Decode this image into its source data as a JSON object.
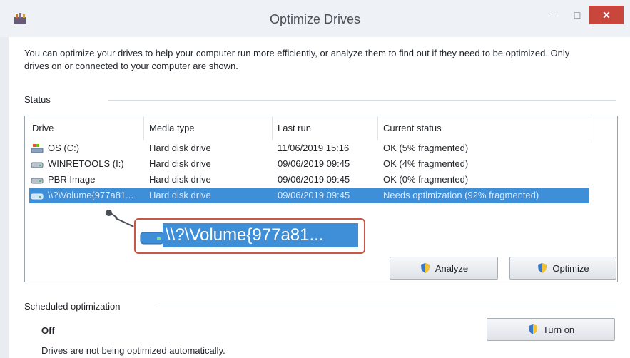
{
  "window": {
    "title": "Optimize Drives",
    "min_symbol": "–",
    "max_symbol": "□",
    "close_symbol": "✕"
  },
  "intro_text": "You can optimize your drives to help your computer run more efficiently, or analyze them to find out if they need to be optimized. Only drives on or connected to your computer are shown.",
  "status": {
    "label": "Status",
    "columns": [
      "Drive",
      "Media type",
      "Last run",
      "Current status"
    ],
    "drives": [
      {
        "drive": "OS (C:)",
        "media": "Hard disk drive",
        "last_run": "11/06/2019 15:16",
        "status": "OK (5% fragmented)",
        "icon": "system-drive-icon"
      },
      {
        "drive": "WINRETOOLS (I:)",
        "media": "Hard disk drive",
        "last_run": "09/06/2019 09:45",
        "status": "OK (4% fragmented)",
        "icon": "hard-drive-icon"
      },
      {
        "drive": "PBR Image",
        "media": "Hard disk drive",
        "last_run": "09/06/2019 09:45",
        "status": "OK (0% fragmented)",
        "icon": "hard-drive-icon"
      },
      {
        "drive": "\\\\?\\Volume{977a81...",
        "media": "Hard disk drive",
        "last_run": "09/06/2019 09:45",
        "status": "Needs optimization (92% fragmented)",
        "icon": "hard-drive-icon",
        "selected": true
      }
    ],
    "callout_text": "\\\\?\\Volume{977a81...",
    "analyze_label": "Analyze",
    "optimize_label": "Optimize"
  },
  "scheduled": {
    "label": "Scheduled optimization",
    "state": "Off",
    "description": "Drives are not being optimized automatically.",
    "turn_on_label": "Turn on"
  },
  "colors": {
    "selection": "#3f8ed8",
    "callout_border": "#c95747",
    "close_button": "#c9463d"
  }
}
